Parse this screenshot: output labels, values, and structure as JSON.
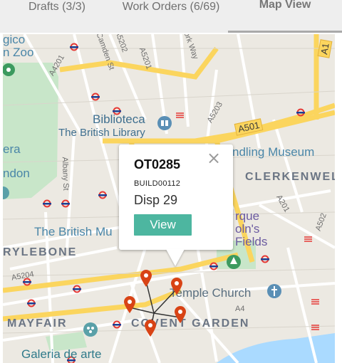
{
  "tabs": [
    {
      "label": "Drafts (3/3)"
    },
    {
      "label": "Work Orders (6/69)"
    },
    {
      "label": "Map View",
      "active": true
    }
  ],
  "map": {
    "area_labels": [
      "CLERKENWELL",
      "RYLEBONE",
      "MAYFAIR",
      "COVENT GARDEN"
    ],
    "poi_labels": [
      "Biblioteca",
      "The British Library",
      "ndling Museum",
      "The British Mu",
      "Temple Church",
      "Galeria de arte",
      "gico",
      "n Zoo",
      "era",
      "ndon",
      "rque",
      "oln's",
      "Fields"
    ],
    "road_labels": [
      "Camden St",
      "A4201",
      "A5202",
      "ork Way",
      "A5203",
      "Albany St",
      "A201",
      "A5204",
      "A4",
      "A5201",
      "A502"
    ],
    "road_badges": [
      "A1",
      "A501"
    ],
    "colors": {
      "water": "#aadaff",
      "park": "#c8e6c9",
      "major_road": "#fbd55e",
      "tube": "#e53935",
      "marker": "#d84315"
    }
  },
  "popup": {
    "id": "OT0285",
    "build": "BUILD00112",
    "disp": "Disp 29",
    "view_label": "View",
    "close_icon": "×"
  },
  "cluster_markers": 5
}
